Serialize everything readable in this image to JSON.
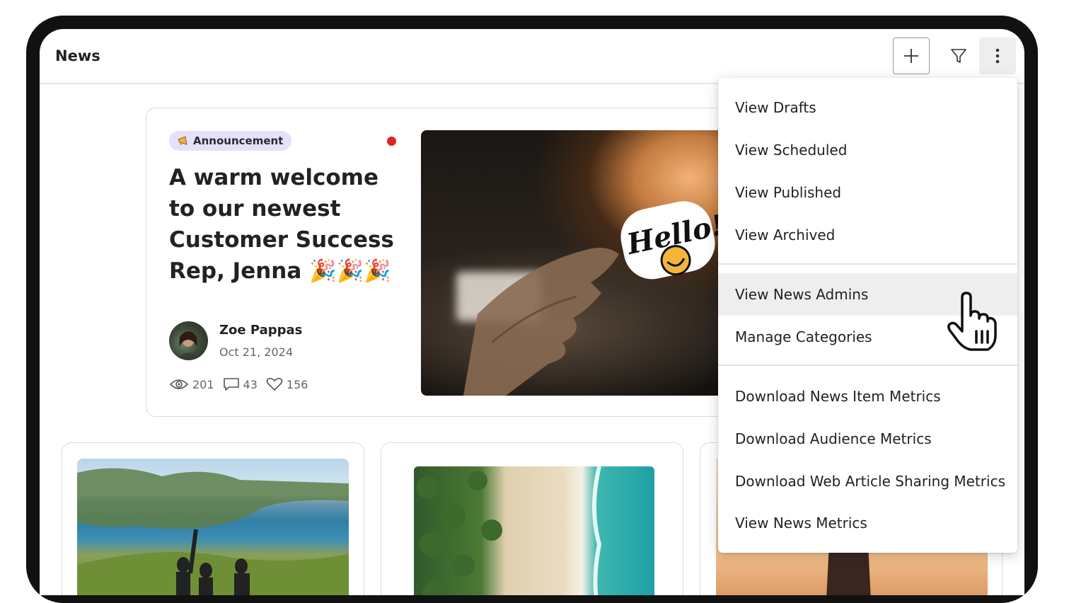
{
  "header": {
    "title": "News"
  },
  "featured": {
    "badge": "Announcement",
    "headline": "A warm welcome to our newest Customer Success Rep, Jenna 🎉🎉🎉",
    "author": "Zoe Pappas",
    "date": "Oct 21, 2024",
    "stats": {
      "views": "201",
      "comments": "43",
      "likes": "156"
    },
    "image_text": "Hello!"
  },
  "menu": {
    "items": [
      "View Drafts",
      "View Scheduled",
      "View Published",
      "View Archived",
      "View News Admins",
      "Manage Categories",
      "Download News Item Metrics",
      "Download Audience Metrics",
      "Download Web Article Sharing Metrics",
      "View News Metrics"
    ],
    "hovered": "View News Admins"
  },
  "colors": {
    "badge_bg": "#e6e0fa",
    "unread_dot": "#e02424",
    "menu_hover_bg": "#eeeeee"
  }
}
